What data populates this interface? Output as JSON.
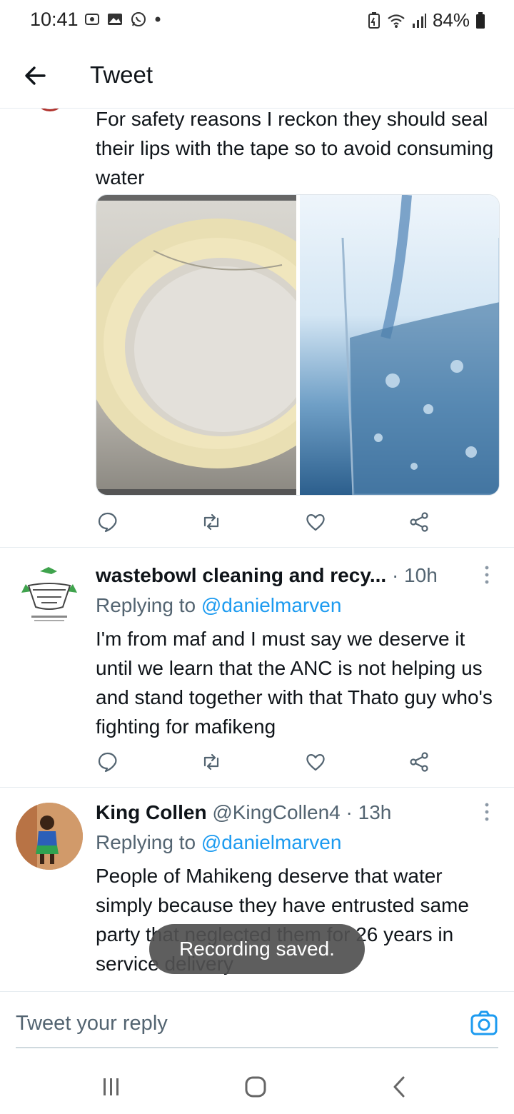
{
  "status_bar": {
    "time": "10:41",
    "battery": "84%"
  },
  "header": {
    "title": "Tweet"
  },
  "main_tweet": {
    "text": "For safety reasons I reckon they should seal their lips with the tape so to avoid consuming water"
  },
  "replies": [
    {
      "name": "wastebowl cleaning and recy...",
      "meta": "· 10h",
      "replying_label": "Replying to ",
      "replying_to": "@danielmarven",
      "text": "I'm from maf and I must  say we deserve it until we learn that the ANC  is not helping us and stand together  with that Thato guy  who's  fighting  for  mafikeng"
    },
    {
      "name": "King Collen",
      "meta": " @KingCollen4 · 13h",
      "replying_label": "Replying to ",
      "replying_to": "@danielmarven",
      "text": "People of Mahikeng deserve that water simply because they have entrusted same party that neglected them for 26 years in service delivery"
    }
  ],
  "toast": {
    "text": "Recording saved."
  },
  "compose": {
    "placeholder": "Tweet your reply"
  },
  "colors": {
    "accent": "#1d9bf0",
    "text": "#0f1419",
    "secondary": "#536471"
  }
}
